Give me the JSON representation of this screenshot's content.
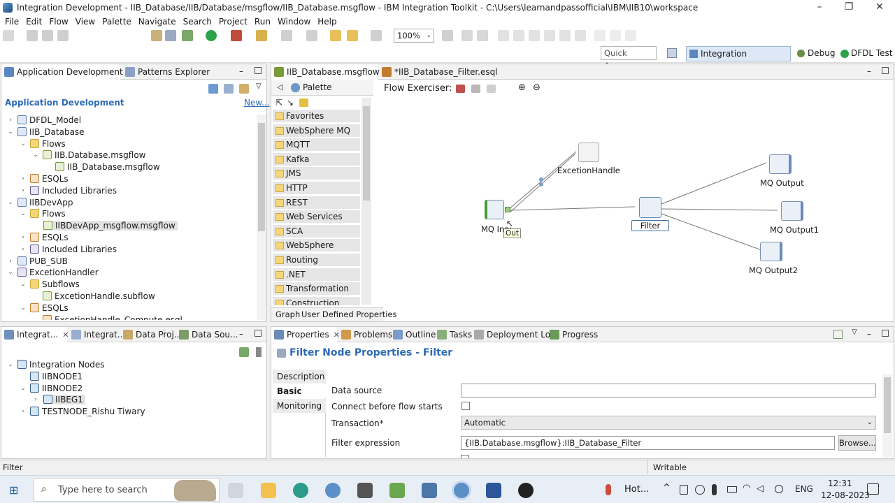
{
  "window": {
    "title": "Integration Development - IIB_Database/IIB/Database/msgflow/IIB_Database.msgflow - IBM Integration Toolkit - C:\\Users\\learnandpassofficial\\IBM\\IIB10\\workspace",
    "minimize": "–",
    "restore": "❐",
    "close": "✕"
  },
  "menu": [
    "File",
    "Edit",
    "Flow",
    "View",
    "Palette",
    "Navigate",
    "Search",
    "Project",
    "Run",
    "Window",
    "Help"
  ],
  "toolbar": {
    "zoom": "100%"
  },
  "perspectives": {
    "quick_access": "Quick Access",
    "items": [
      "Integration Development",
      "Debug",
      "DFDL Test"
    ]
  },
  "left_panel": {
    "tabs": [
      "Application Development",
      "Patterns Explorer"
    ],
    "header": "Application Development",
    "new_link": "New...",
    "tree": [
      {
        "label": "DFDL_Model",
        "icon": "proj",
        "indent": 0,
        "tw": "›"
      },
      {
        "label": "IIB_Database",
        "icon": "proj",
        "indent": 0,
        "tw": "⌄"
      },
      {
        "label": "Flows",
        "icon": "folder",
        "indent": 1,
        "tw": "⌄"
      },
      {
        "label": "IIB.Database.msgflow",
        "icon": "flow",
        "indent": 2,
        "tw": "⌄"
      },
      {
        "label": "IIB_Database.msgflow",
        "icon": "flow",
        "indent": 3,
        "tw": ""
      },
      {
        "label": "ESQLs",
        "icon": "esql",
        "indent": 1,
        "tw": "›"
      },
      {
        "label": "Included Libraries",
        "icon": "lib",
        "indent": 1,
        "tw": "›"
      },
      {
        "label": "IIBDevApp",
        "icon": "proj",
        "indent": 0,
        "tw": "⌄"
      },
      {
        "label": "Flows",
        "icon": "folder",
        "indent": 1,
        "tw": "⌄"
      },
      {
        "label": "IIBDevApp_msgflow.msgflow",
        "icon": "flow",
        "indent": 2,
        "tw": "",
        "selected": true
      },
      {
        "label": "ESQLs",
        "icon": "esql",
        "indent": 1,
        "tw": "›"
      },
      {
        "label": "Included Libraries",
        "icon": "lib",
        "indent": 1,
        "tw": "›"
      },
      {
        "label": "PUB_SUB",
        "icon": "proj",
        "indent": 0,
        "tw": "›"
      },
      {
        "label": "ExcetionHandler",
        "icon": "lib",
        "indent": 0,
        "tw": "⌄"
      },
      {
        "label": "Subflows",
        "icon": "folder",
        "indent": 1,
        "tw": "⌄"
      },
      {
        "label": "ExcetionHandle.subflow",
        "icon": "flow",
        "indent": 2,
        "tw": ""
      },
      {
        "label": "ESQLs",
        "icon": "esql",
        "indent": 1,
        "tw": "⌄"
      },
      {
        "label": "ExcetionHandle_Compute.esql",
        "icon": "esql",
        "indent": 2,
        "tw": ""
      }
    ]
  },
  "bottom_left": {
    "tabs": [
      "Integrat...",
      "Integrat...",
      "Data Proj...",
      "Data Sou..."
    ],
    "tree": [
      {
        "label": "Integration Nodes",
        "indent": 0,
        "tw": "⌄"
      },
      {
        "label": "IIBNODE1",
        "indent": 1,
        "tw": ""
      },
      {
        "label": "IIBNODE2",
        "indent": 1,
        "tw": "⌄"
      },
      {
        "label": "IIBEG1",
        "indent": 2,
        "tw": "›",
        "selected": true
      },
      {
        "label": "TESTNODE_Rishu Tiwary",
        "indent": 1,
        "tw": "›"
      }
    ]
  },
  "editor": {
    "tabs": [
      "IIB_Database.msgflow",
      "*IIB_Database_Filter.esql"
    ],
    "palette_title": "Palette",
    "palette_items": [
      "Favorites",
      "WebSphere MQ",
      "MQTT",
      "Kafka",
      "JMS",
      "HTTP",
      "REST",
      "Web Services",
      "SCA",
      "WebSphere Adapters",
      "Routing",
      ".NET",
      "Transformation",
      "Construction"
    ],
    "flow_exerciser": "Flow Exerciser:",
    "nodes": {
      "mq_input": "MQ Input",
      "excetion": "ExcetionHandle",
      "filter": "Filter",
      "mq_output": "MQ Output",
      "mq_output1": "MQ Output1",
      "mq_output2": "MQ Output2",
      "tooltip": "Out"
    },
    "bottom_tabs": [
      "Graph",
      "User Defined Properties"
    ]
  },
  "properties": {
    "tabs": [
      "Properties",
      "Problems",
      "Outline",
      "Tasks",
      "Deployment Log",
      "Progress"
    ],
    "title": "Filter Node Properties - Filter",
    "sections": [
      "Description",
      "Basic",
      "Monitoring"
    ],
    "fields": {
      "data_source_label": "Data source",
      "data_source_value": "",
      "connect_label": "Connect before flow starts",
      "transaction_label": "Transaction*",
      "transaction_value": "Automatic",
      "filter_label": "Filter expression",
      "filter_value": "{IIB.Database.msgflow}:IIB_Database_Filter",
      "browse": "Browse..."
    }
  },
  "statusbar": {
    "left": "Filter",
    "right": "Writable"
  },
  "taskbar": {
    "search": "Type here to search",
    "weather": "Hot...",
    "lang": "ENG",
    "time": "12:31",
    "date": "12-08-2023"
  }
}
